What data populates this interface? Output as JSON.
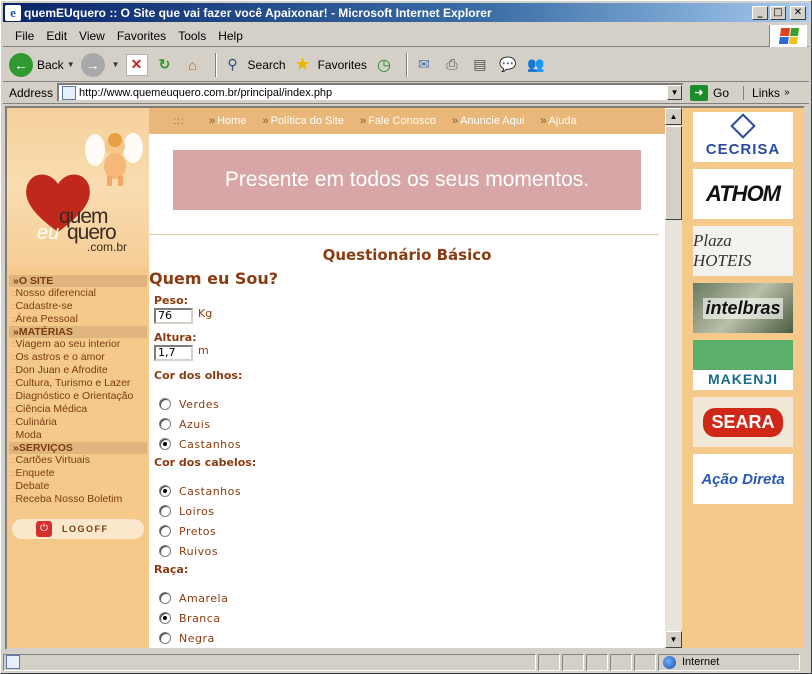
{
  "window": {
    "title": "quemEUquero :: O Site que vai fazer você Apaixonar! - Microsoft Internet Explorer"
  },
  "menubar": [
    "File",
    "Edit",
    "View",
    "Favorites",
    "Tools",
    "Help"
  ],
  "toolbar": {
    "back": "Back",
    "search": "Search",
    "favorites": "Favorites"
  },
  "address": {
    "label": "Address",
    "url": "http://www.quemeuquero.com.br/principal/index.php",
    "go": "Go",
    "links": "Links"
  },
  "logo": {
    "quem": "quem",
    "eu": "eu",
    "quero": "quero",
    "domain": ".com.br"
  },
  "topnav": {
    "grip": ":::",
    "links": [
      "Home",
      "Política do Site",
      "Fale Conosco",
      "Anuncie Aqui",
      "Ajuda"
    ]
  },
  "leftnav": {
    "site_section": "»O SITE",
    "site_items": [
      "Nosso diferencial",
      "Cadastre-se",
      "Área Pessoal"
    ],
    "materias_section": "»MATÉRIAS",
    "materias_items": [
      "Viagem ao seu interior",
      "Os astros e o amor",
      "Don Juan e Afrodite",
      "Cultura, Turismo e Lazer",
      "Diagnóstico e Orientação",
      "Ciência Médica",
      "Culinária",
      "Moda"
    ],
    "servicos_section": "»SERVIÇOS",
    "servicos_items": [
      "Cartões Virtuais",
      "Enquete",
      "Debate",
      "Receba Nosso Boletim"
    ],
    "logoff": "LOGOFF"
  },
  "main": {
    "banner": "Presente em todos os seus momentos.",
    "questionnaire_title": "Questionário Básico",
    "section_title": "Quem eu Sou?",
    "peso_label": "Peso:",
    "peso_value": "76",
    "peso_unit": "Kg",
    "altura_label": "Altura:",
    "altura_value": "1,7",
    "altura_unit": "m",
    "olhos_label": "Cor dos olhos:",
    "olhos_options": [
      "Verdes",
      "Azuis",
      "Castanhos"
    ],
    "olhos_selected": "Castanhos",
    "cabelos_label": "Cor dos cabelos:",
    "cabelos_options": [
      "Castanhos",
      "Loiros",
      "Pretos",
      "Ruivos"
    ],
    "cabelos_selected": "Castanhos",
    "raca_label": "Raça:",
    "raca_options": [
      "Amarela",
      "Branca",
      "Negra"
    ],
    "raca_selected": "Branca"
  },
  "sponsors": [
    "CECRISA",
    "ATHOM",
    "Plaza HOTEIS",
    "intelbras",
    "MAKENJI",
    "SEARA",
    "Ação Direta"
  ],
  "status": {
    "zone": "Internet"
  },
  "colors": {
    "accent_brown": "#8a3c10",
    "sidebar_orange": "#f5c98a",
    "banner_pink": "#d8a6a6",
    "titlebar_blue": "#0a246a"
  }
}
